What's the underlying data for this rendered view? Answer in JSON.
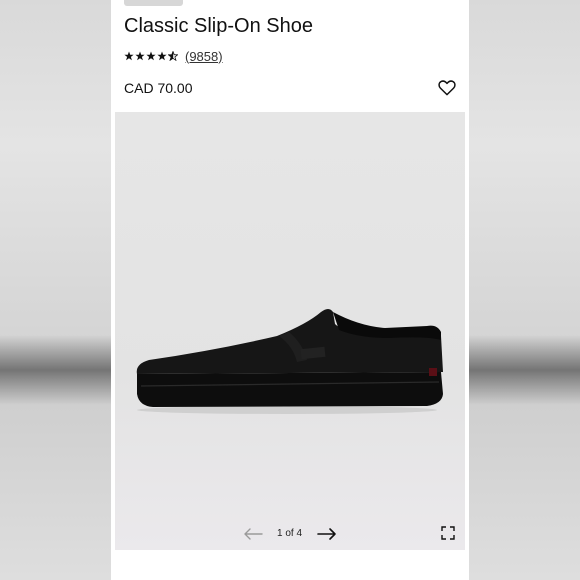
{
  "product": {
    "title": "Classic Slip-On Shoe",
    "rating_stars": 4.5,
    "review_count": "(9858)",
    "price": "CAD 70.00"
  },
  "icons": {
    "wishlist": "heart-icon",
    "prev": "arrow-left-icon",
    "next": "arrow-right-icon",
    "fullscreen": "expand-icon",
    "star": "star-icon"
  },
  "gallery": {
    "image": "shoe-image",
    "pager_text": "1 of 4",
    "current_page": 1,
    "total_pages": 4
  },
  "colors": {
    "text": "#111111",
    "gallery_bg": "#e6e6e6",
    "arrow_disabled": "#9a9a9a",
    "arrow_enabled": "#111111"
  }
}
